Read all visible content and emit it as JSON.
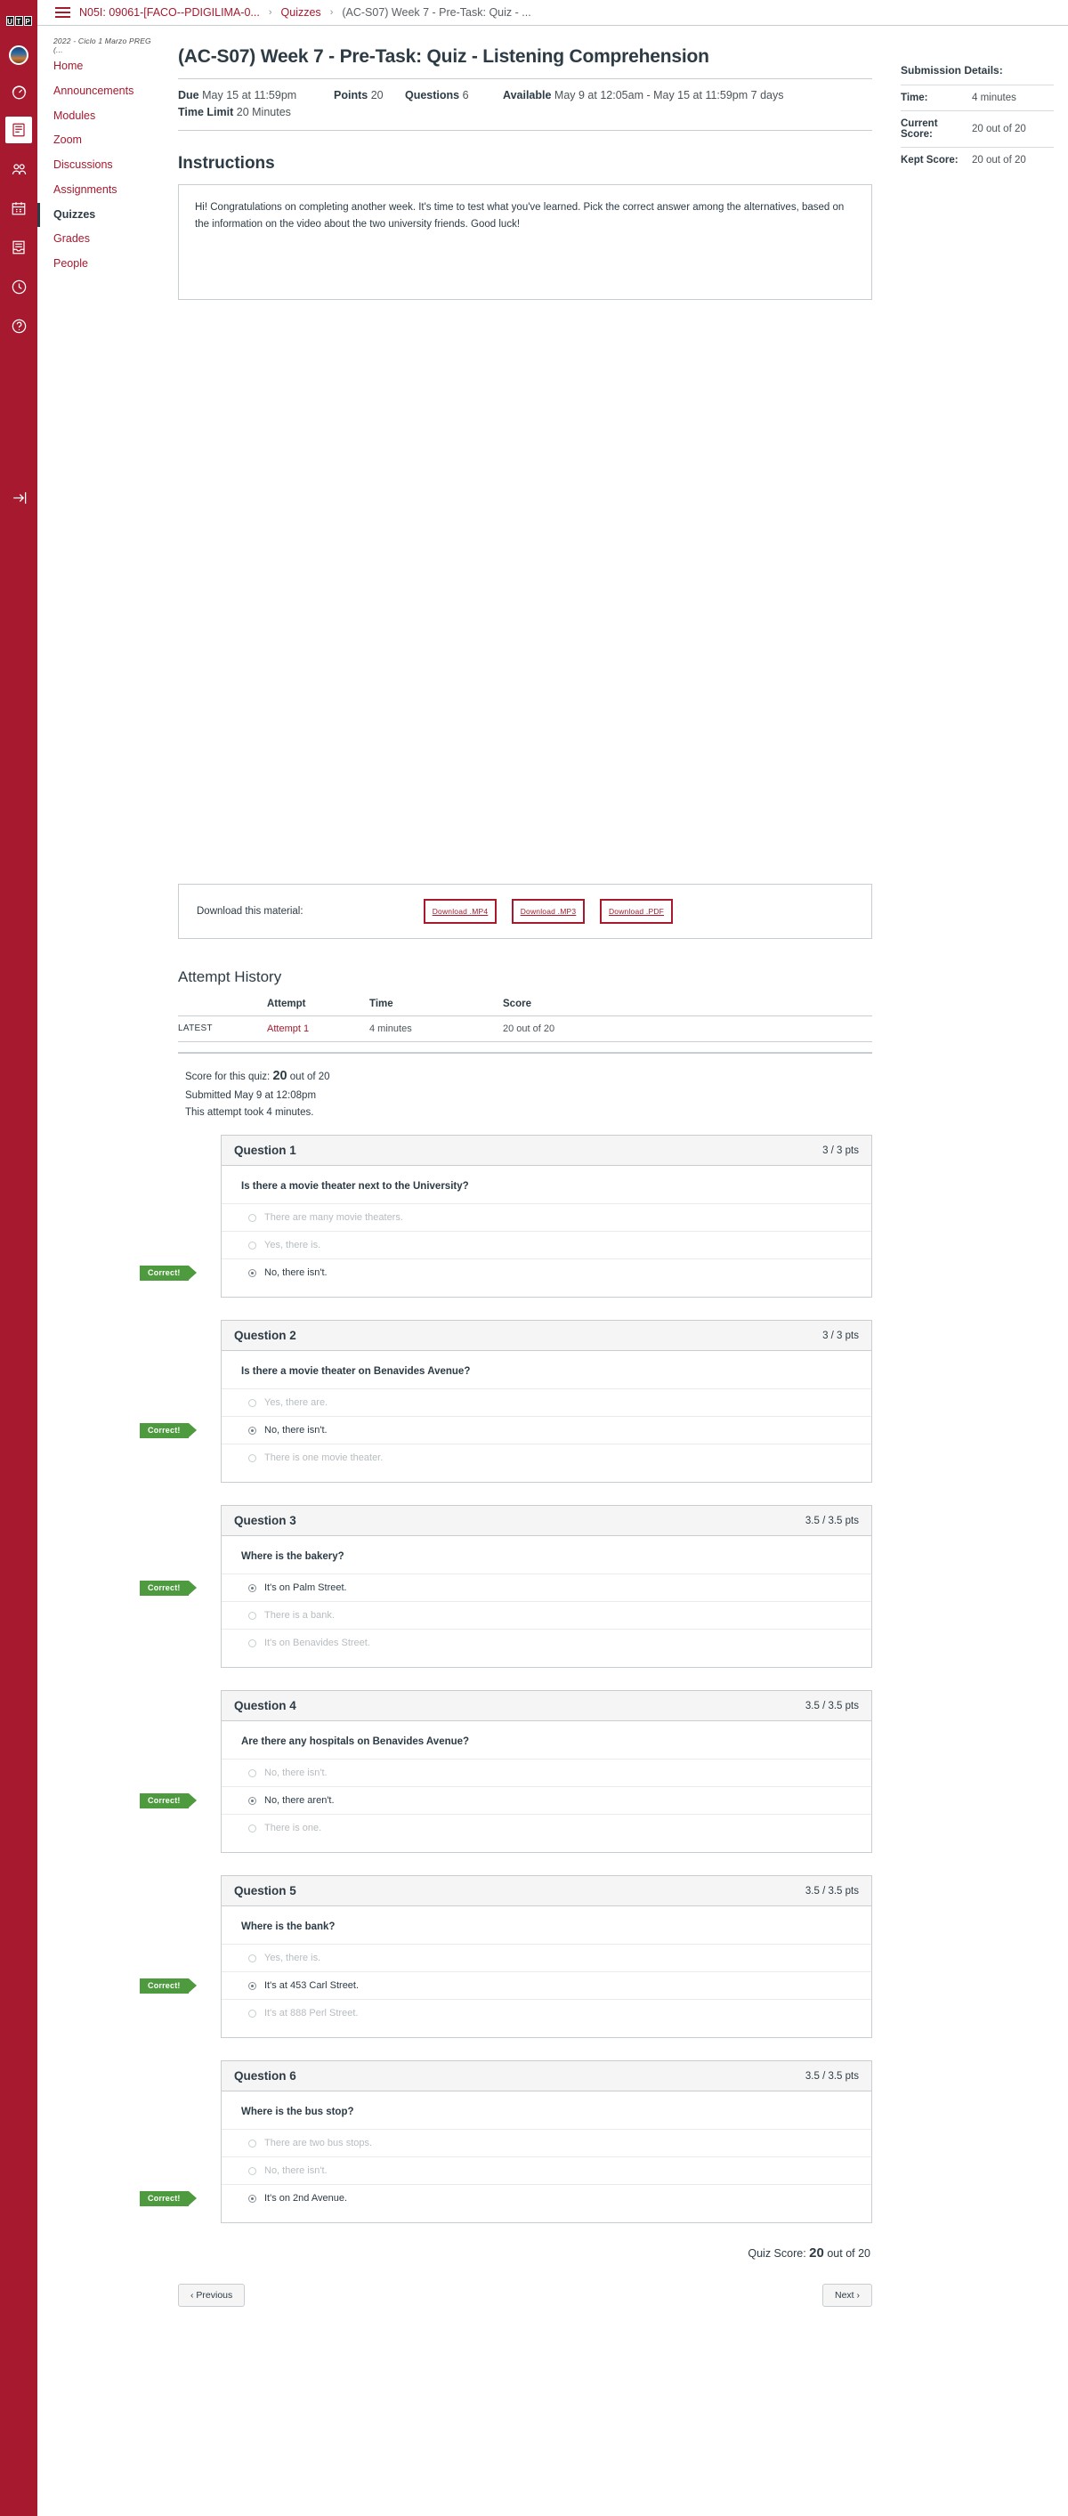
{
  "global_nav": {
    "logo": [
      "U",
      "T",
      "P"
    ],
    "items": [
      {
        "name": "account-avatar",
        "icon": "avatar"
      },
      {
        "name": "dashboard",
        "icon": "dashboard-icon"
      },
      {
        "name": "courses",
        "icon": "courses-book-icon",
        "active": true
      },
      {
        "name": "groups",
        "icon": "groups-people-icon"
      },
      {
        "name": "calendar",
        "icon": "calendar-icon"
      },
      {
        "name": "inbox",
        "icon": "inbox-icon"
      },
      {
        "name": "history",
        "icon": "clock-history-icon"
      },
      {
        "name": "help",
        "icon": "help-question-icon"
      },
      {
        "name": "collapse",
        "icon": "arrow-right-logout-icon"
      }
    ]
  },
  "breadcrumb": {
    "course": "N05I: 09061-[FACO--PDIGILIMA-0...",
    "section": "Quizzes",
    "current": "(AC-S07) Week 7 - Pre-Task: Quiz - ...",
    "separator": "›"
  },
  "course_nav": {
    "term": "2022 - Ciclo 1 Marzo PREG (...",
    "items": [
      {
        "label": "Home",
        "current": false
      },
      {
        "label": "Announcements",
        "current": false
      },
      {
        "label": "Modules",
        "current": false
      },
      {
        "label": "Zoom",
        "current": false
      },
      {
        "label": "Discussions",
        "current": false
      },
      {
        "label": "Assignments",
        "current": false
      },
      {
        "label": "Quizzes",
        "current": true
      },
      {
        "label": "Grades",
        "current": false
      },
      {
        "label": "People",
        "current": false
      }
    ]
  },
  "quiz": {
    "title": "(AC-S07) Week 7 - Pre-Task: Quiz - Listening Comprehension",
    "meta": {
      "due_label": "Due",
      "due_value": "May 15 at 11:59pm",
      "points_label": "Points",
      "points_value": "20",
      "questions_label": "Questions",
      "questions_value": "6",
      "available_label": "Available",
      "available_value": "May 9 at 12:05am - May 15 at 11:59pm",
      "available_duration": "7 days",
      "time_limit_label": "Time Limit",
      "time_limit_value": "20 Minutes"
    },
    "instructions_heading": "Instructions",
    "instructions_text": "Hi! Congratulations on completing another week. It's time to test what you've learned. Pick the correct answer among the alternatives, based on the information on the video about the two university friends. Good luck!"
  },
  "download": {
    "label": "Download this material:",
    "buttons": [
      "Download .MP4",
      "Download .MP3",
      "Download .PDF"
    ]
  },
  "attempt_history": {
    "heading": "Attempt History",
    "columns": [
      "",
      "Attempt",
      "Time",
      "Score"
    ],
    "rows": [
      {
        "tag": "LATEST",
        "attempt": "Attempt 1",
        "time": "4 minutes",
        "score": "20 out of 20"
      }
    ]
  },
  "score_summary": {
    "prefix": "Score for this quiz:",
    "score": "20",
    "suffix": "out of 20",
    "submitted": "Submitted May 9 at 12:08pm",
    "duration": "This attempt took 4 minutes."
  },
  "questions": [
    {
      "name": "Question 1",
      "points": "3 / 3 pts",
      "text": "Is there a movie theater next to the University?",
      "answers": [
        {
          "text": "There are many movie theaters.",
          "selected": false
        },
        {
          "text": "Yes, there is.",
          "selected": false
        },
        {
          "text": "No, there isn't.",
          "selected": true
        }
      ],
      "flag": "Correct!",
      "flag_index": 2
    },
    {
      "name": "Question 2",
      "points": "3 / 3 pts",
      "text": "Is there a movie theater on Benavides Avenue?",
      "answers": [
        {
          "text": "Yes, there are.",
          "selected": false
        },
        {
          "text": "No, there isn't.",
          "selected": true
        },
        {
          "text": "There is one movie theater.",
          "selected": false
        }
      ],
      "flag": "Correct!",
      "flag_index": 1
    },
    {
      "name": "Question 3",
      "points": "3.5 / 3.5 pts",
      "text": "Where is the bakery?",
      "answers": [
        {
          "text": "It's on Palm Street.",
          "selected": true
        },
        {
          "text": "There is a bank.",
          "selected": false
        },
        {
          "text": "It's on Benavides Street.",
          "selected": false
        }
      ],
      "flag": "Correct!",
      "flag_index": 0
    },
    {
      "name": "Question 4",
      "points": "3.5 / 3.5 pts",
      "text": "Are there any hospitals on Benavides Avenue?",
      "answers": [
        {
          "text": "No, there isn't.",
          "selected": false
        },
        {
          "text": "No, there aren't.",
          "selected": true
        },
        {
          "text": "There is one.",
          "selected": false
        }
      ],
      "flag": "Correct!",
      "flag_index": 1
    },
    {
      "name": "Question 5",
      "points": "3.5 / 3.5 pts",
      "text": "Where is the bank?",
      "answers": [
        {
          "text": "Yes, there is.",
          "selected": false
        },
        {
          "text": "It's at 453 Carl Street.",
          "selected": true
        },
        {
          "text": "It's at 888 Perl Street.",
          "selected": false
        }
      ],
      "flag": "Correct!",
      "flag_index": 1
    },
    {
      "name": "Question 6",
      "points": "3.5 / 3.5 pts",
      "text": "Where is the bus stop?",
      "answers": [
        {
          "text": "There are two bus stops.",
          "selected": false
        },
        {
          "text": "No, there isn't.",
          "selected": false
        },
        {
          "text": "It's on 2nd Avenue.",
          "selected": true
        }
      ],
      "flag": "Correct!",
      "flag_index": 2
    }
  ],
  "quiz_score_total": {
    "prefix": "Quiz Score:",
    "score": "20",
    "suffix": "out of 20"
  },
  "pager": {
    "previous": "‹ Previous",
    "next": "Next ›"
  },
  "submission_details": {
    "title": "Submission Details:",
    "rows": [
      {
        "key": "Time:",
        "value": "4 minutes"
      },
      {
        "key": "Current Score:",
        "value": "20 out of 20"
      },
      {
        "key": "Kept Score:",
        "value": "20 out of 20"
      }
    ]
  },
  "colors": {
    "brand_red": "#a6192e",
    "correct_green": "#4e9a3e",
    "text": "#2d3b45",
    "border": "#c7cdd1"
  }
}
